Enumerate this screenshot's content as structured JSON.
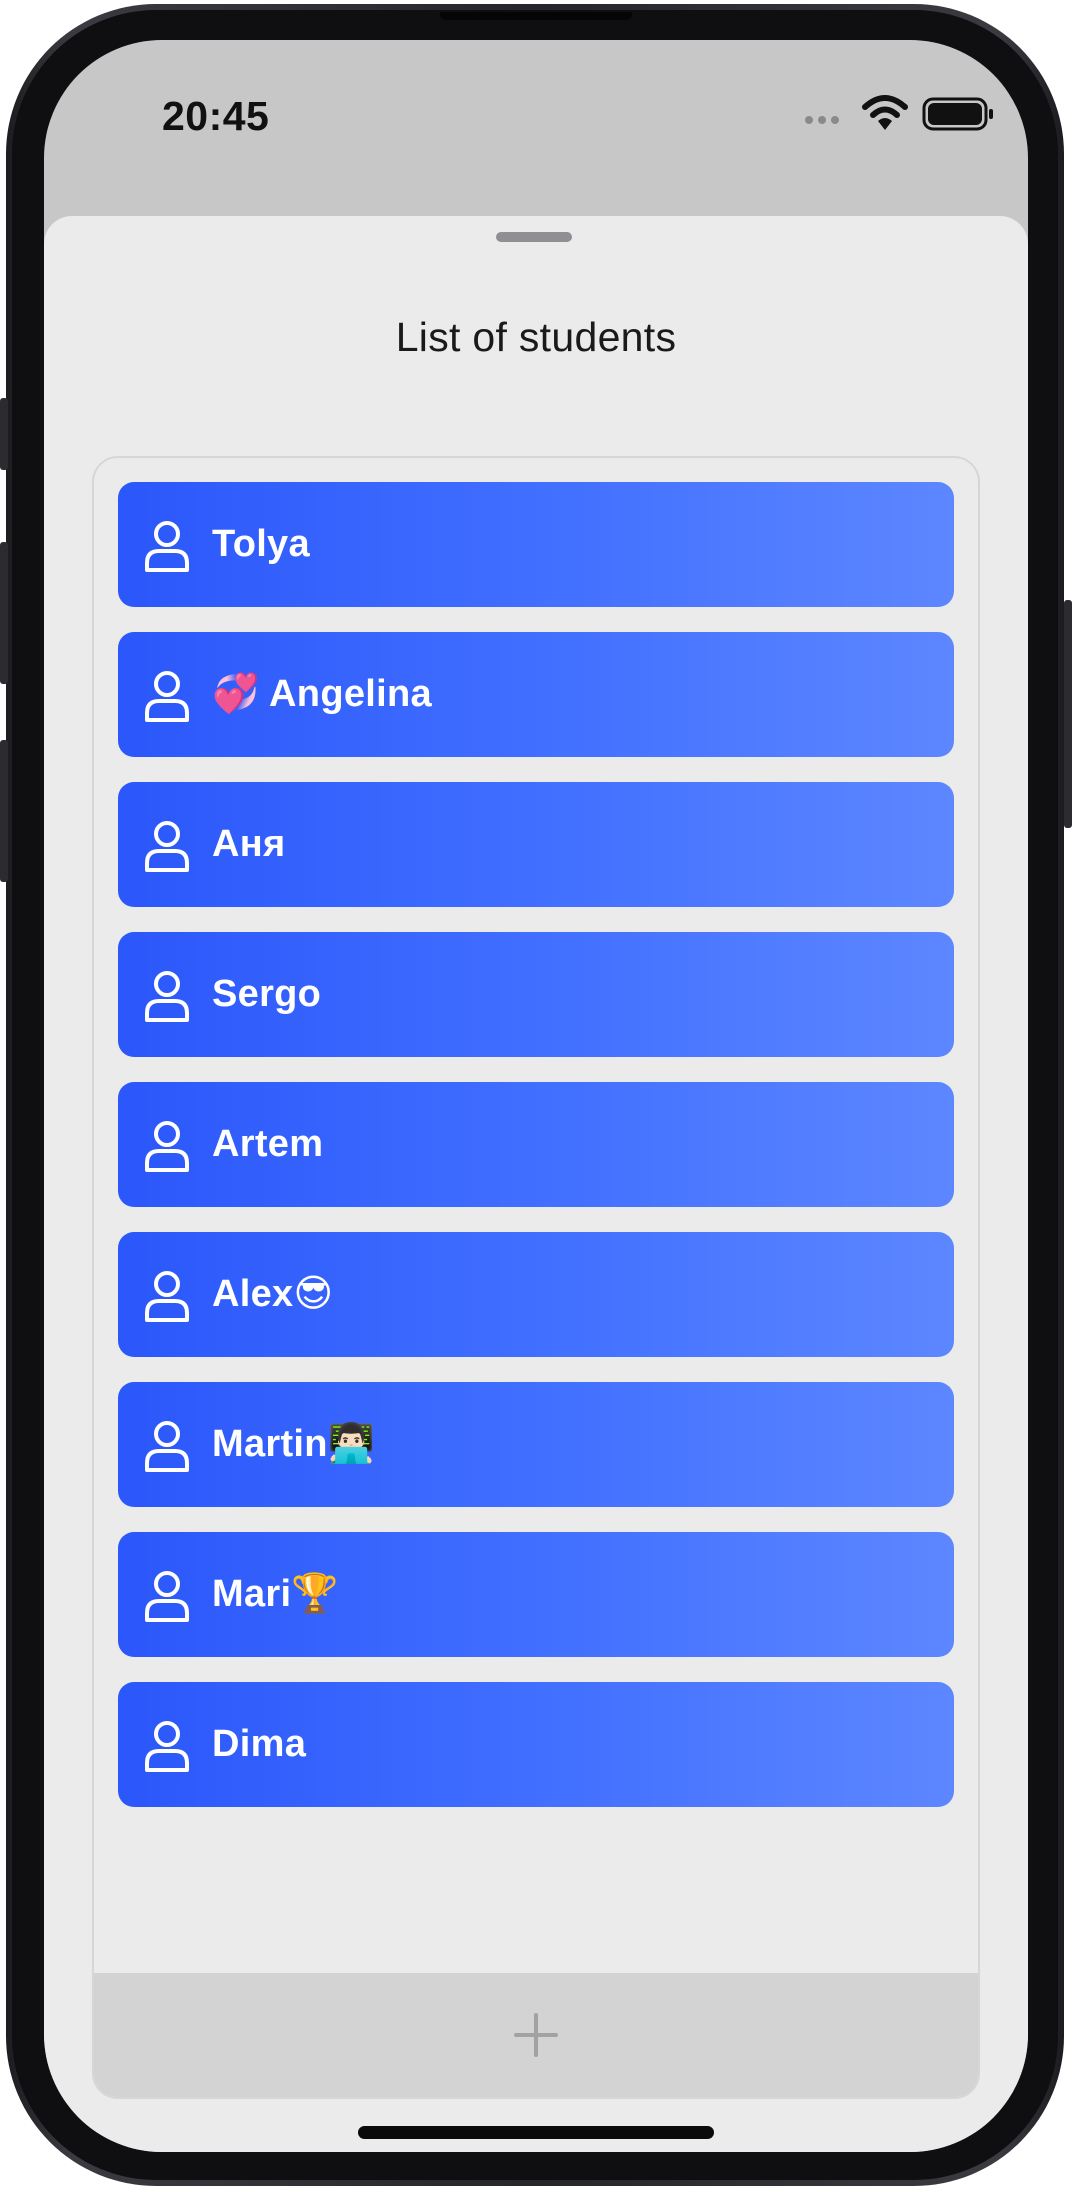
{
  "status_bar": {
    "time": "20:45",
    "icons": [
      "signal-dots-icon",
      "wifi-icon",
      "battery-icon"
    ]
  },
  "sheet": {
    "title": "List of students"
  },
  "students": [
    {
      "name": "Tolya",
      "icon": "person-icon"
    },
    {
      "name": "💞 Angelina",
      "icon": "person-icon"
    },
    {
      "name": "Аня",
      "icon": "person-icon"
    },
    {
      "name": "Sergo",
      "icon": "person-icon"
    },
    {
      "name": "Artem",
      "icon": "person-icon"
    },
    {
      "name": "Alex😎",
      "icon": "person-icon"
    },
    {
      "name": "Martin👨🏻‍💻",
      "icon": "person-icon"
    },
    {
      "name": "Mari🏆",
      "icon": "person-icon"
    },
    {
      "name": "Dima",
      "icon": "person-icon"
    }
  ],
  "add_button": {
    "icon": "plus-icon"
  },
  "colors": {
    "card_gradient_start": "#2b57fb",
    "card_gradient_end": "#5d87ff",
    "sheet_background": "#ebebeb",
    "add_bar_background": "#d3d3d3"
  }
}
